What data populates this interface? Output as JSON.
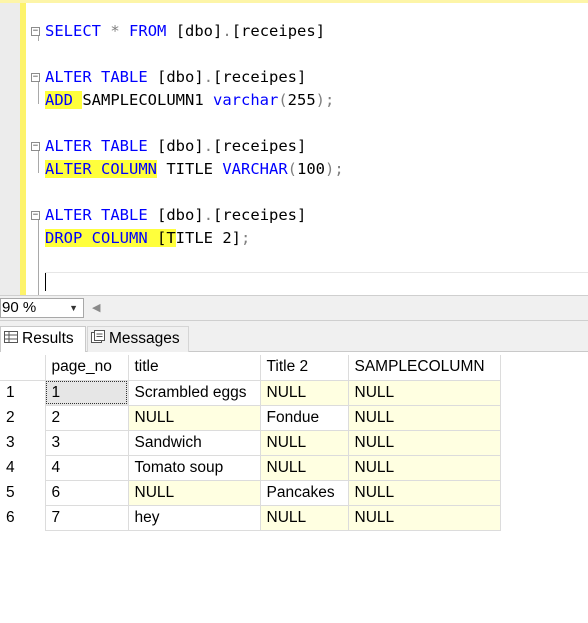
{
  "editor": {
    "lines": [
      {
        "parts": [
          {
            "t": "SELECT",
            "c": "kw"
          },
          {
            "t": " "
          },
          {
            "t": "*",
            "c": "op"
          },
          {
            "t": " "
          },
          {
            "t": "FROM",
            "c": "kw"
          },
          {
            "t": " [dbo]"
          },
          {
            "t": ".",
            "c": "op"
          },
          {
            "t": "[receipes]"
          }
        ]
      },
      {
        "parts": [
          {
            "t": "ALTER",
            "c": "kw"
          },
          {
            "t": " "
          },
          {
            "t": "TABLE",
            "c": "kw"
          },
          {
            "t": " [dbo]"
          },
          {
            "t": ".",
            "c": "op"
          },
          {
            "t": "[receipes]"
          }
        ]
      },
      {
        "parts": [
          {
            "t": "ADD",
            "c": "kw hl"
          },
          {
            "t": " ",
            "c": "hl"
          },
          {
            "t": "SAMPLECOLUMN1 "
          },
          {
            "t": "varchar",
            "c": "kw"
          },
          {
            "t": "(",
            "c": "op"
          },
          {
            "t": "255"
          },
          {
            "t": ");",
            "c": "op"
          }
        ]
      },
      {
        "parts": [
          {
            "t": "ALTER",
            "c": "kw"
          },
          {
            "t": " "
          },
          {
            "t": "TABLE",
            "c": "kw"
          },
          {
            "t": " [dbo]"
          },
          {
            "t": ".",
            "c": "op"
          },
          {
            "t": "[receipes]"
          }
        ]
      },
      {
        "parts": [
          {
            "t": "ALTER",
            "c": "kw hl"
          },
          {
            "t": " ",
            "c": "hl"
          },
          {
            "t": "COLUMN",
            "c": "kw hl"
          },
          {
            "t": " TITLE "
          },
          {
            "t": "VARCHAR",
            "c": "kw"
          },
          {
            "t": "(",
            "c": "op"
          },
          {
            "t": "100"
          },
          {
            "t": ");",
            "c": "op"
          }
        ]
      },
      {
        "parts": [
          {
            "t": "ALTER",
            "c": "kw"
          },
          {
            "t": " "
          },
          {
            "t": "TABLE",
            "c": "kw"
          },
          {
            "t": " [dbo]"
          },
          {
            "t": ".",
            "c": "op"
          },
          {
            "t": "[receipes]"
          }
        ]
      },
      {
        "parts": [
          {
            "t": "DROP",
            "c": "kw hl"
          },
          {
            "t": " ",
            "c": "hl"
          },
          {
            "t": "COLUMN",
            "c": "kw hl"
          },
          {
            "t": " [T",
            "c": "hl"
          },
          {
            "t": "ITLE 2]"
          },
          {
            "t": ";",
            "c": "op"
          }
        ]
      }
    ]
  },
  "zoom": {
    "value": "90 %"
  },
  "tabs": {
    "results": "Results",
    "messages": "Messages"
  },
  "results": {
    "columns": [
      "page_no",
      "title",
      "Title 2",
      "SAMPLECOLUMN"
    ],
    "rows": [
      {
        "num": "1",
        "cells": [
          "1",
          "Scrambled eggs",
          "NULL",
          "NULL"
        ]
      },
      {
        "num": "2",
        "cells": [
          "2",
          "NULL",
          "Fondue",
          "NULL"
        ]
      },
      {
        "num": "3",
        "cells": [
          "3",
          "Sandwich",
          "NULL",
          "NULL"
        ]
      },
      {
        "num": "4",
        "cells": [
          "4",
          "Tomato soup",
          "NULL",
          "NULL"
        ]
      },
      {
        "num": "5",
        "cells": [
          "6",
          "NULL",
          "Pancakes",
          "NULL"
        ]
      },
      {
        "num": "6",
        "cells": [
          "7",
          "hey",
          "NULL",
          "NULL"
        ]
      }
    ]
  },
  "colors": {
    "keyword": "#0000ff",
    "highlight": "#ffff3c",
    "null_cell": "#ffffe1"
  }
}
